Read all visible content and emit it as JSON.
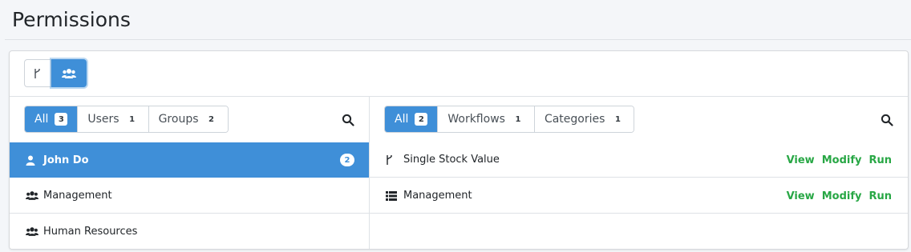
{
  "page": {
    "title": "Permissions"
  },
  "mode_toggle": {
    "options": [
      {
        "icon": "workflow-branch-icon",
        "active": false
      },
      {
        "icon": "users-group-icon",
        "active": true
      }
    ]
  },
  "left_panel": {
    "filters": [
      {
        "label": "All",
        "count": "3",
        "active": true
      },
      {
        "label": "Users",
        "count": "1",
        "active": false
      },
      {
        "label": "Groups",
        "count": "2",
        "active": false
      }
    ],
    "items": [
      {
        "label": "John Do",
        "icon": "user-icon",
        "badge": "2",
        "selected": true
      },
      {
        "label": "Management",
        "icon": "users-group-icon",
        "selected": false
      },
      {
        "label": "Human Resources",
        "icon": "users-group-icon",
        "selected": false
      }
    ]
  },
  "right_panel": {
    "filters": [
      {
        "label": "All",
        "count": "2",
        "active": true
      },
      {
        "label": "Workflows",
        "count": "1",
        "active": false
      },
      {
        "label": "Categories",
        "count": "1",
        "active": false
      }
    ],
    "items": [
      {
        "label": "Single Stock Value",
        "icon": "workflow-branch-icon",
        "actions": [
          "View",
          "Modify",
          "Run"
        ]
      },
      {
        "label": "Management",
        "icon": "list-icon",
        "actions": [
          "View",
          "Modify",
          "Run"
        ]
      }
    ]
  },
  "colors": {
    "accent": "#3f8fd8",
    "success": "#28a745",
    "border": "#dee2e6"
  }
}
